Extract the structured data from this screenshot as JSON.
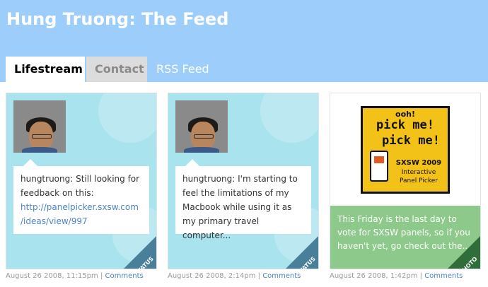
{
  "header": {
    "title": "Hung Truong: The Feed",
    "bg_color": "#9dcdfb"
  },
  "tabs": [
    {
      "label": "Lifestream",
      "active": true
    },
    {
      "label": "Contact",
      "active": false
    },
    {
      "label": "RSS Feed",
      "active": false
    }
  ],
  "cards": [
    {
      "type": "status",
      "text": "hungtruong: Still looking for feedback on this:",
      "link": "http://panelpicker.sxsw.com/ideas/view/997",
      "link_line1": "http://panelpicker.sxsw.com",
      "link_line2": "/ideas/view/997",
      "corner_label": "STATUS",
      "date": "August 26 2008, 11:15pm",
      "comments_label": "Comments"
    },
    {
      "type": "status",
      "text": "hungtruong: I'm starting to feel the limitations of my Macbook while using it as my primary travel computer...",
      "corner_label": "STATUS",
      "date": "August 26 2008, 2:14pm",
      "comments_label": "Comments"
    },
    {
      "type": "photo",
      "promo": {
        "line1": "ooh!",
        "line2": "pick me!",
        "line3": "pick me!",
        "line4": "SXSW 2009",
        "line5": "Interactive",
        "line6": "Panel Picker"
      },
      "text": "This Friday is the last day to vote for SXSW panels, so if you haven't yet, go check out the...",
      "corner_label": "PHOTO",
      "date": "August 26 2008, 1:42pm",
      "comments_label": "Comments"
    }
  ],
  "separator": "|",
  "colors": {
    "status_card_bg": "#a9e3ee",
    "photo_text_bg": "#8cc98a",
    "link": "#4a86c8",
    "promo_yellow": "#f3c219"
  }
}
